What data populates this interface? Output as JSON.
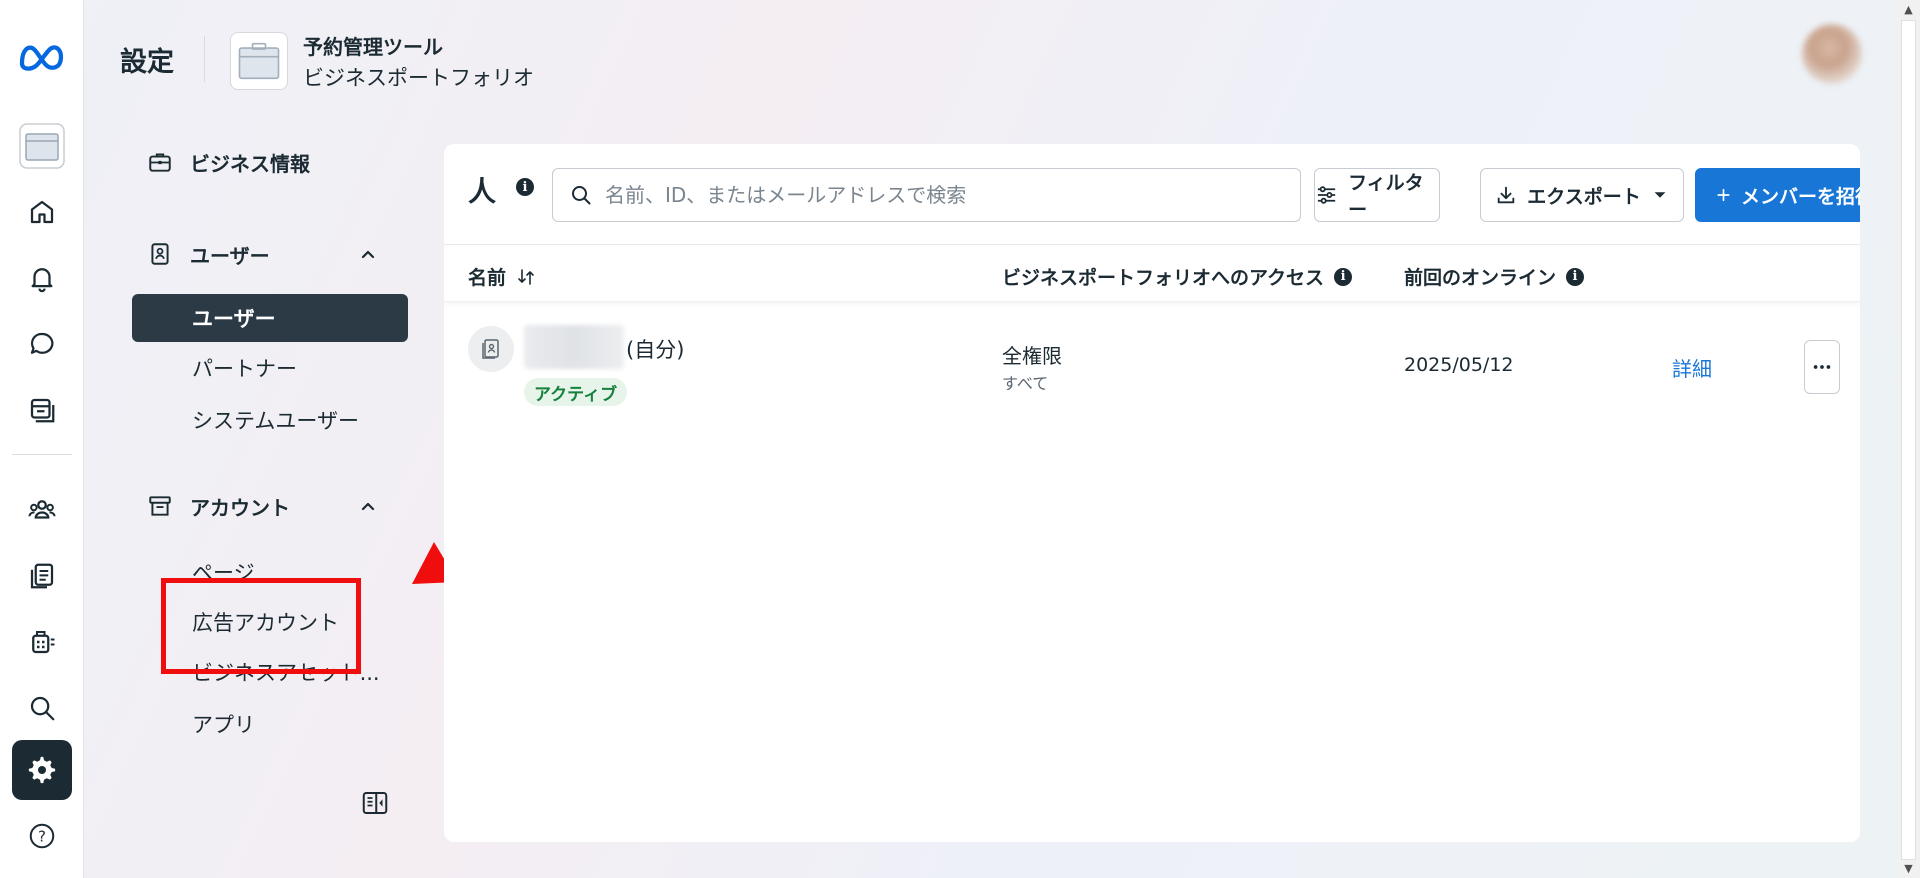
{
  "header": {
    "page_title": "設定",
    "business_name": "予約管理ツール",
    "business_type": "ビジネスポートフォリオ"
  },
  "rail": {
    "items": [
      "meta-logo",
      "business-portfolio",
      "home",
      "notifications",
      "messages",
      "content",
      "people",
      "pages",
      "ads",
      "search",
      "settings",
      "help"
    ],
    "active": "settings"
  },
  "nav": {
    "business_info": "ビジネス情報",
    "users_section": "ユーザー",
    "users_items": [
      "ユーザー",
      "パートナー",
      "システムユーザー"
    ],
    "accounts_section": "アカウント",
    "accounts_items": [
      "ページ",
      "広告アカウント",
      "ビジネスアセット...",
      "アプリ"
    ]
  },
  "main": {
    "title": "人",
    "search_placeholder": "名前、ID、またはメールアドレスで検索",
    "filter_label": "フィルター",
    "export_label": "エクスポート",
    "invite_label": "メンバーを招待",
    "columns": {
      "name": "名前",
      "access": "ビジネスポートフォリオへのアクセス",
      "last_online": "前回のオンライン"
    },
    "rows": [
      {
        "name_suffix": "(自分)",
        "status": "アクティブ",
        "access_main": "全権限",
        "access_sub": "すべて",
        "last_online": "2025/05/12",
        "details": "詳細"
      }
    ]
  },
  "colors": {
    "primary": "#1877d6",
    "dark": "#1c2b33",
    "highlight": "#f00d0d",
    "active_badge_bg": "#e6f4ea",
    "active_badge_text": "#17813c"
  }
}
